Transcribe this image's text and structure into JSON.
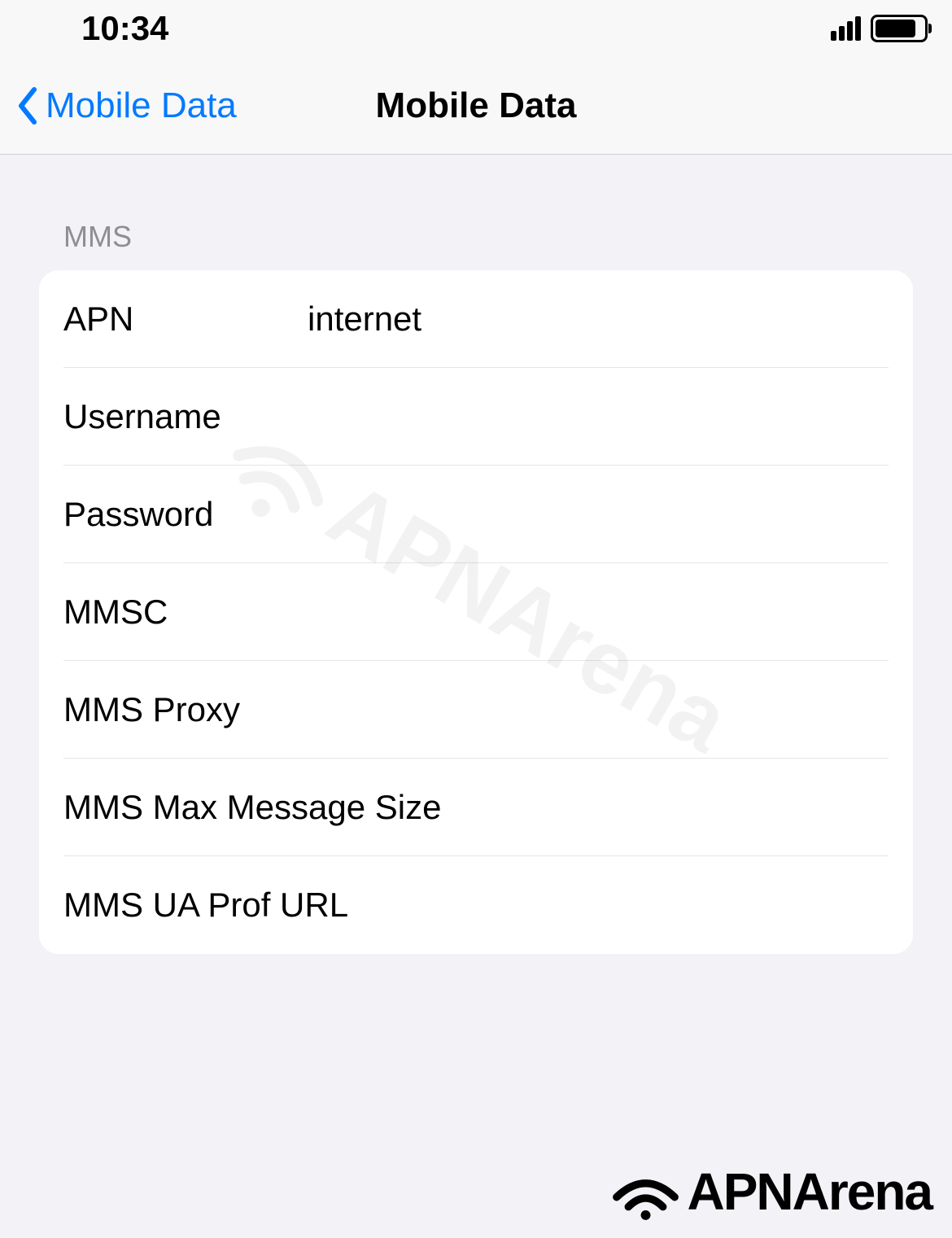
{
  "statusBar": {
    "time": "10:34"
  },
  "nav": {
    "backLabel": "Mobile Data",
    "title": "Mobile Data"
  },
  "section": {
    "header": "MMS",
    "rows": [
      {
        "label": "APN",
        "value": "internet"
      },
      {
        "label": "Username",
        "value": ""
      },
      {
        "label": "Password",
        "value": ""
      },
      {
        "label": "MMSC",
        "value": ""
      },
      {
        "label": "MMS Proxy",
        "value": ""
      },
      {
        "label": "MMS Max Message Size",
        "value": ""
      },
      {
        "label": "MMS UA Prof URL",
        "value": ""
      }
    ]
  },
  "watermark": {
    "text": "APNArena"
  },
  "footer": {
    "text": "APNArena"
  }
}
